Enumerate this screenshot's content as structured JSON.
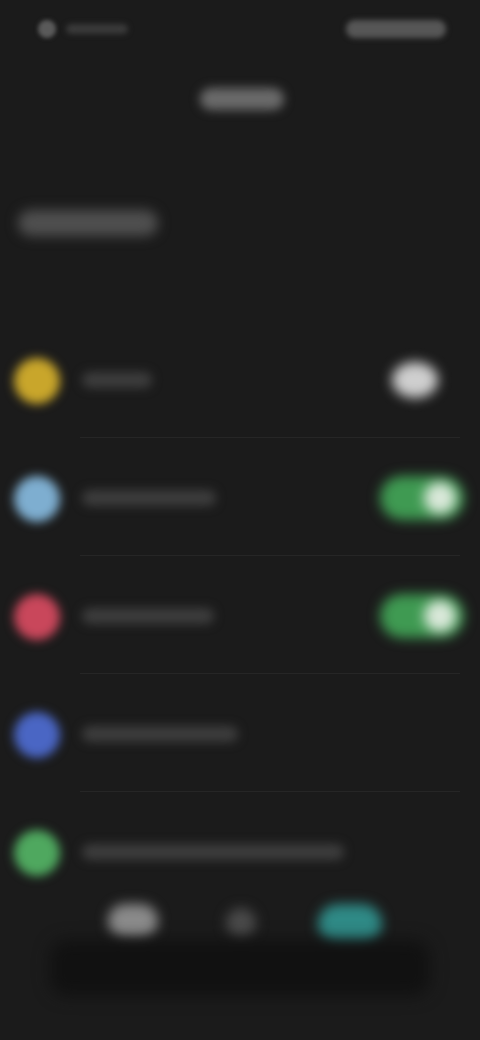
{
  "status_bar": {
    "time": "",
    "indicators": ""
  },
  "header": {
    "title": ""
  },
  "section": {
    "heading": ""
  },
  "settings": {
    "rows": [
      {
        "label": "",
        "icon": "yellow-circle-icon",
        "icon_color": "#c9a62b",
        "toggle": "off",
        "label_width": "70px"
      },
      {
        "label": "",
        "icon": "light-blue-circle-icon",
        "icon_color": "#7eaed0",
        "toggle": "on",
        "label_width": "134px"
      },
      {
        "label": "",
        "icon": "red-circle-icon",
        "icon_color": "#c9475b",
        "toggle": "on",
        "label_width": "132px"
      },
      {
        "label": "",
        "icon": "blue-circle-icon",
        "icon_color": "#4a66c4",
        "toggle": null,
        "label_width": "156px"
      },
      {
        "label": "",
        "icon": "green-circle-icon",
        "icon_color": "#4fa85f",
        "toggle": null,
        "label_width": "262px"
      }
    ]
  },
  "bottom_nav": {
    "items": [
      {
        "icon": "home-icon"
      },
      {
        "icon": "dot-icon"
      },
      {
        "icon": "active-tab-icon",
        "color": "#2f8a86"
      }
    ]
  },
  "colors": {
    "background": "#1b1b1b",
    "toggle_on": "#3f9a52",
    "accent": "#2f8a86"
  }
}
